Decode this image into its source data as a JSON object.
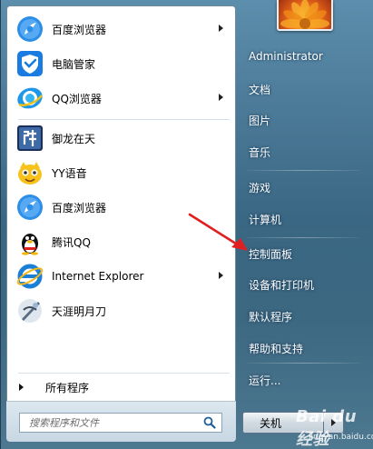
{
  "start_menu": {
    "pinned_items": [
      {
        "label": "百度浏览器",
        "icon": "baidu-browser-icon",
        "has_submenu": true
      },
      {
        "label": "电脑管家",
        "icon": "tencent-pc-manager-icon",
        "has_submenu": false
      },
      {
        "label": "QQ浏览器",
        "icon": "qq-browser-icon",
        "has_submenu": true
      }
    ],
    "recent_items": [
      {
        "label": "御龙在天",
        "icon": "yulong-zaitian-icon",
        "has_submenu": false
      },
      {
        "label": "YY语音",
        "icon": "yy-voice-icon",
        "has_submenu": false
      },
      {
        "label": "百度浏览器",
        "icon": "baidu-browser-icon",
        "has_submenu": false
      },
      {
        "label": "腾讯QQ",
        "icon": "qq-penguin-icon",
        "has_submenu": false
      },
      {
        "label": "Internet Explorer",
        "icon": "internet-explorer-icon",
        "has_submenu": true
      },
      {
        "label": "天涯明月刀",
        "icon": "tianya-mingyuedao-icon",
        "has_submenu": false
      }
    ],
    "all_programs_label": "所有程序",
    "search": {
      "placeholder": "搜索程序和文件",
      "icon": "search-icon"
    }
  },
  "right_pane": {
    "user_name": "Administrator",
    "items": [
      {
        "label": "文档"
      },
      {
        "label": "图片"
      },
      {
        "label": "音乐"
      },
      {
        "label": "游戏"
      },
      {
        "label": "计算机"
      },
      {
        "label": "控制面板"
      },
      {
        "label": "设备和打印机"
      },
      {
        "label": "默认程序"
      },
      {
        "label": "帮助和支持"
      },
      {
        "label": "运行..."
      }
    ],
    "shutdown_label": "关机"
  },
  "watermark": {
    "brand": "Bai du 经验",
    "url": "jingyan.baidu.com"
  },
  "colors": {
    "annotation_arrow": "#e02020",
    "left_pane_bg": "#ffffff",
    "right_pane_text": "#ffffff"
  }
}
